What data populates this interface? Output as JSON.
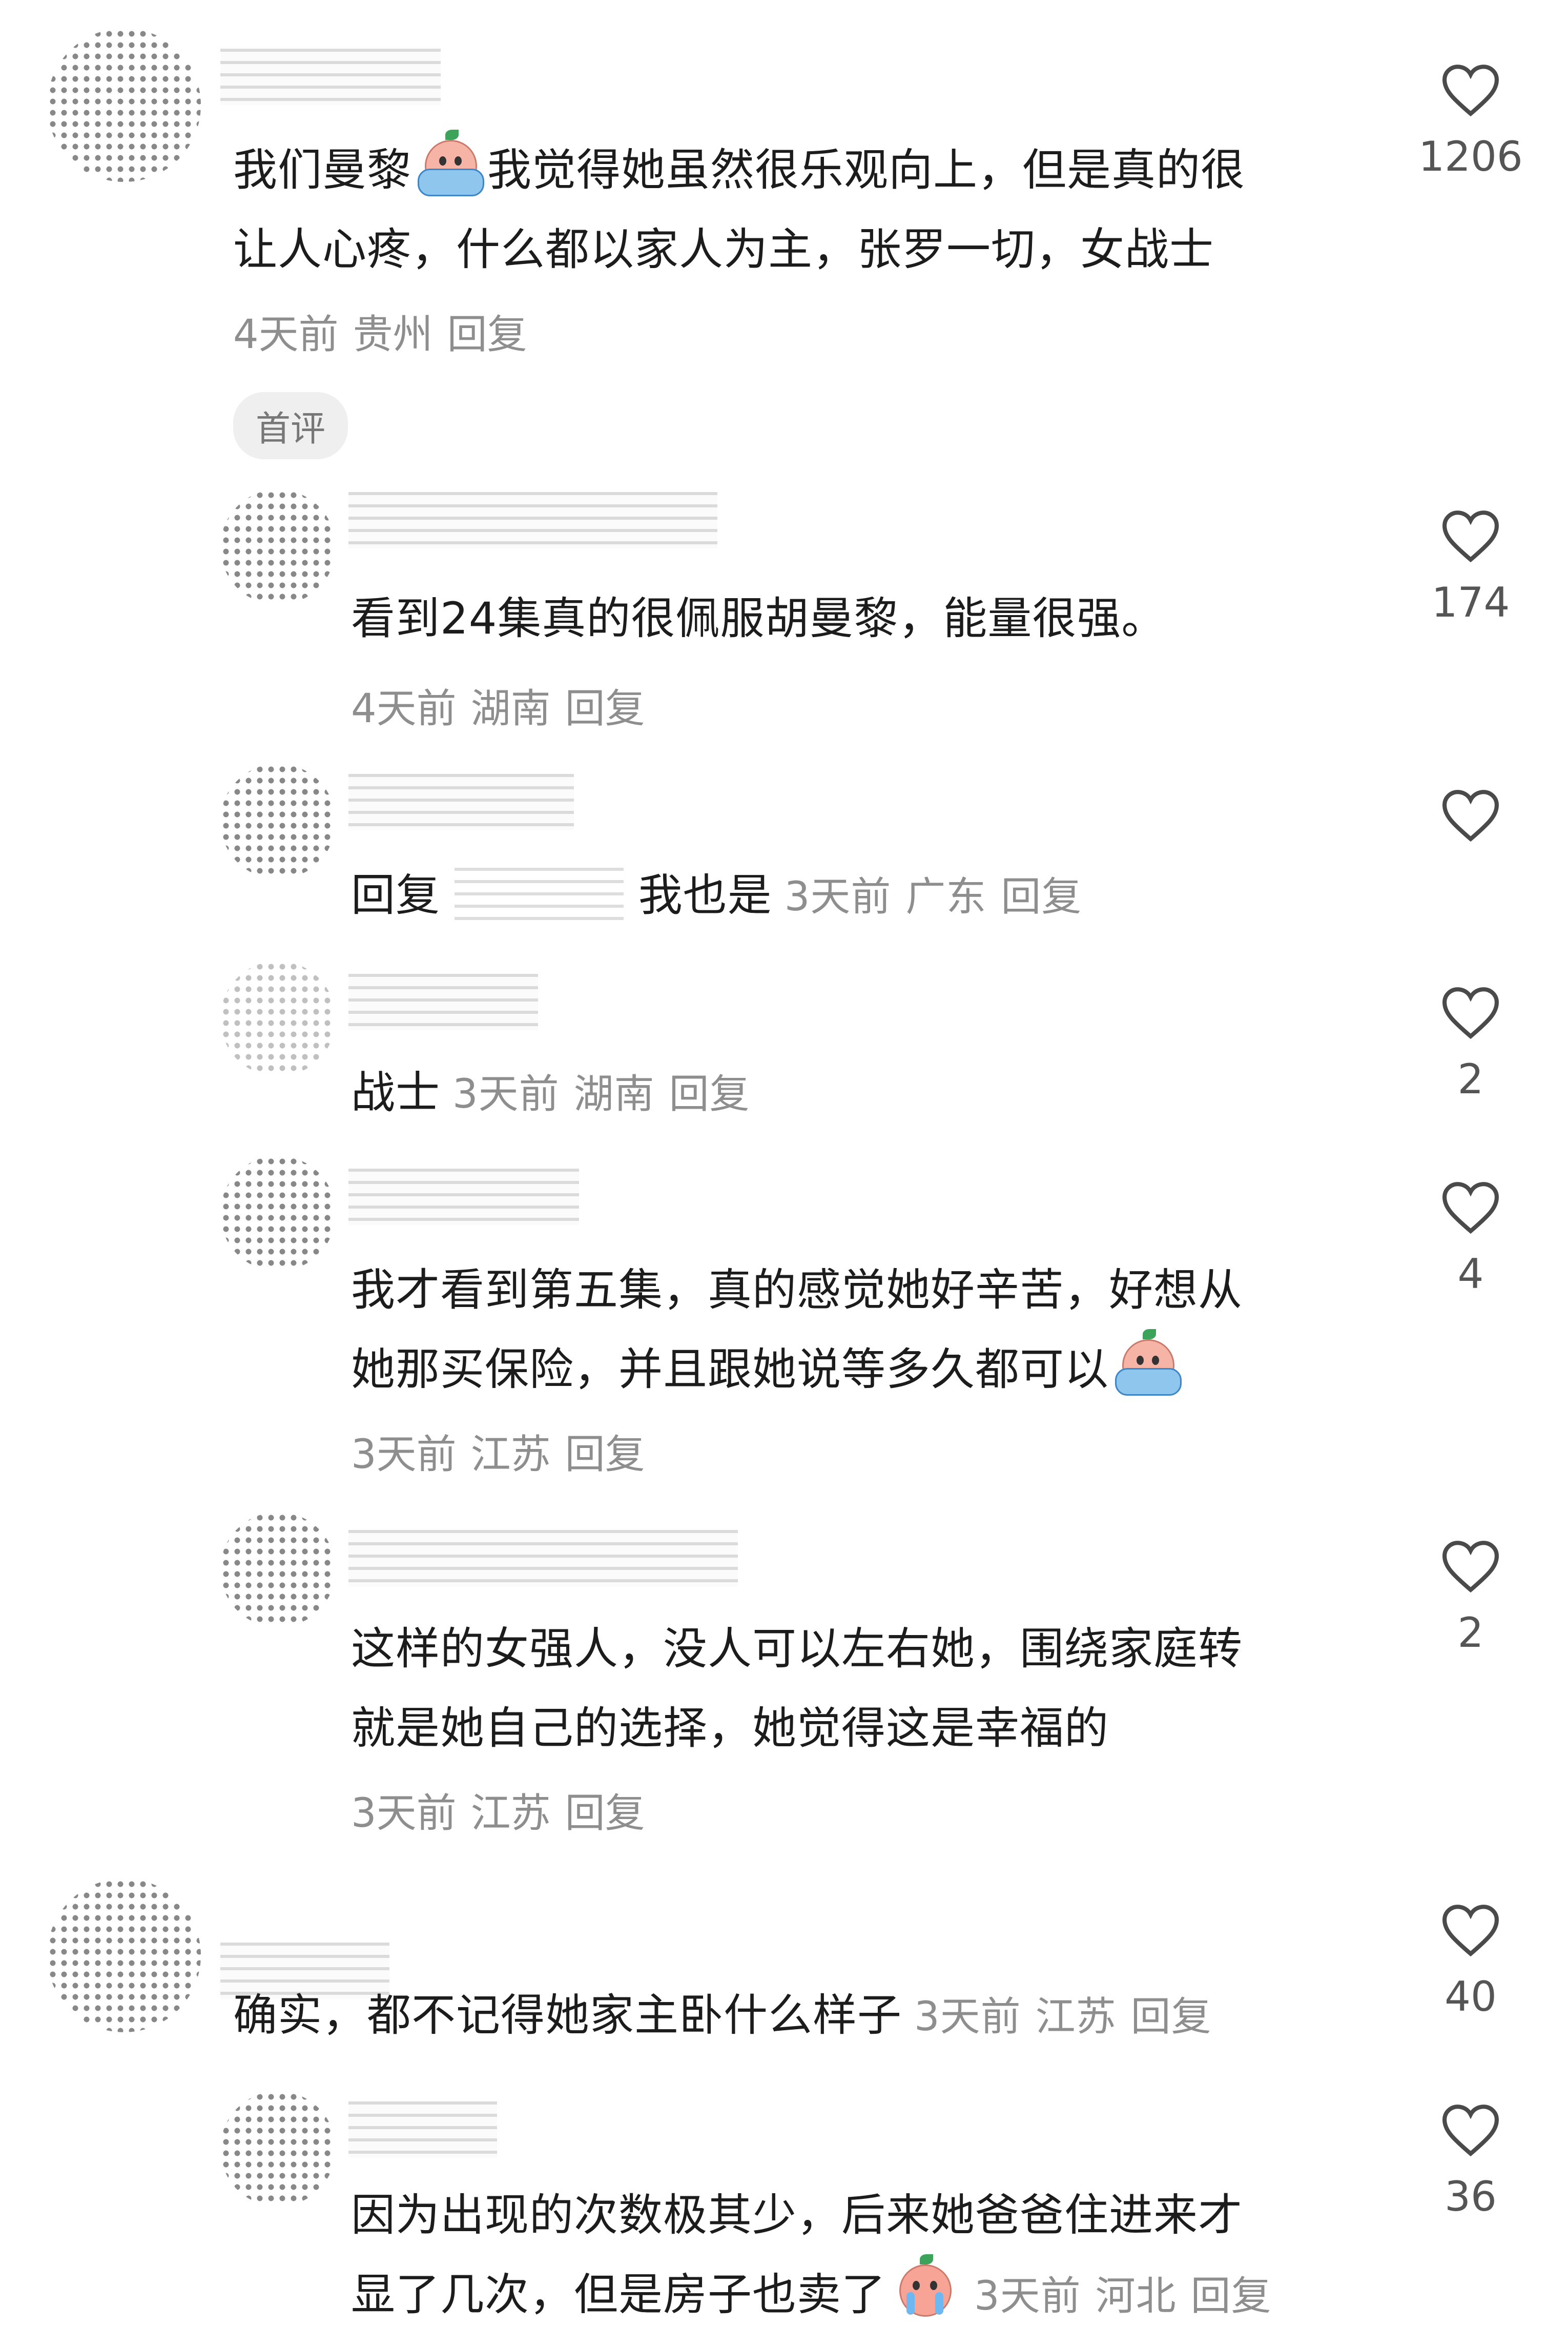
{
  "comments": [
    {
      "text_lines": [
        "我们曼黎",
        "我觉得她虽然很乐观向上，但是真的很",
        "让人心疼，什么都以家人为主，张罗一切，女战士"
      ],
      "meta": {
        "time": "4天前",
        "location": "贵州",
        "reply": "回复"
      },
      "likes": "1206",
      "badge": "首评"
    },
    {
      "text_lines": [
        "看到24集真的很佩服胡曼黎，能量很强。"
      ],
      "meta": {
        "time": "4天前",
        "location": "湖南",
        "reply": "回复"
      },
      "likes": "174"
    },
    {
      "prefix": "回复",
      "text": "我也是",
      "meta": {
        "time": "3天前",
        "location": "广东",
        "reply": "回复"
      },
      "likes": ""
    },
    {
      "text": "战士",
      "meta": {
        "time": "3天前",
        "location": "湖南",
        "reply": "回复"
      },
      "likes": "2"
    },
    {
      "text_lines": [
        "我才看到第五集，真的感觉她好辛苦，好想从",
        "她那买保险，并且跟她说等多久都可以"
      ],
      "meta": {
        "time": "3天前",
        "location": "江苏",
        "reply": "回复"
      },
      "likes": "4"
    },
    {
      "text_lines": [
        "这样的女强人，没人可以左右她，围绕家庭转",
        "就是她自己的选择，她觉得这是幸福的"
      ],
      "meta": {
        "time": "3天前",
        "location": "江苏",
        "reply": "回复"
      },
      "likes": "2"
    },
    {
      "text": "确实，都不记得她家主卧什么样子",
      "meta": {
        "time": "3天前",
        "location": "江苏",
        "reply": "回复"
      },
      "likes": "40"
    },
    {
      "text_lines": [
        "因为出现的次数极其少，后来她爸爸住进来才",
        "显了几次，但是房子也卖了"
      ],
      "meta": {
        "time": "3天前",
        "location": "河北",
        "reply": "回复"
      },
      "likes": "36"
    }
  ],
  "icons": {
    "like": "heart-outline-icon",
    "emoji_cry": "crying-face-emoji",
    "emoji_tears": "tears-face-emoji"
  },
  "colors": {
    "text": "#1c1c1c",
    "meta": "#8e8e8e",
    "badge_bg": "#efefef"
  }
}
